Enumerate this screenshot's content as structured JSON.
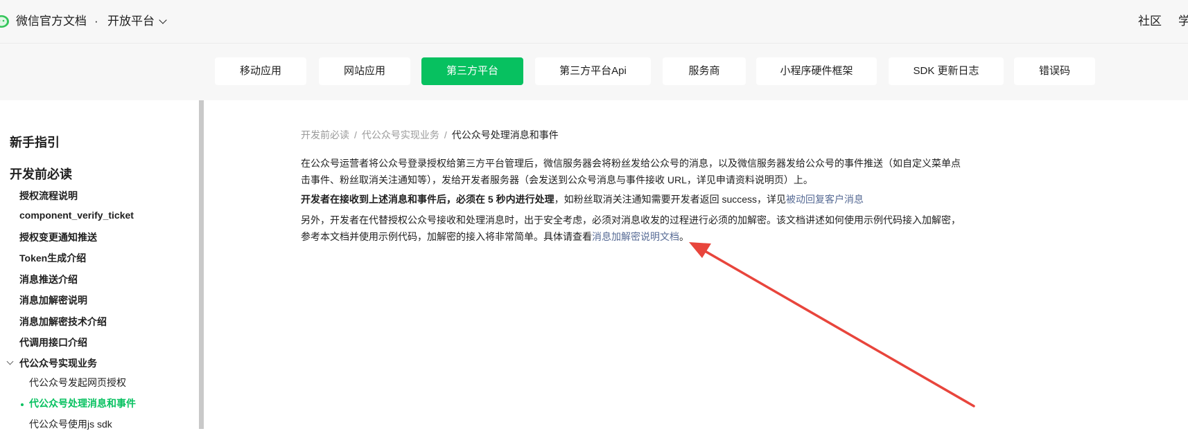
{
  "header": {
    "site_title": "微信官方文档",
    "separator": "·",
    "platform_label": "开放平台",
    "nav_right": [
      "社区",
      "学"
    ]
  },
  "tabs": [
    {
      "label": "移动应用",
      "active": false
    },
    {
      "label": "网站应用",
      "active": false
    },
    {
      "label": "第三方平台",
      "active": true
    },
    {
      "label": "第三方平台Api",
      "active": false
    },
    {
      "label": "服务商",
      "active": false
    },
    {
      "label": "小程序硬件框架",
      "active": false
    },
    {
      "label": "SDK 更新日志",
      "active": false
    },
    {
      "label": "错误码",
      "active": false
    }
  ],
  "sidebar": {
    "headings": [
      "新手指引",
      "开发前必读"
    ],
    "items": [
      "授权流程说明",
      "component_verify_ticket",
      "授权变更通知推送",
      "Token生成介绍",
      "消息推送介绍",
      "消息加解密说明",
      "消息加解密技术介绍",
      "代调用接口介绍",
      "代公众号实现业务"
    ],
    "sub_items": [
      "代公众号发起网页授权",
      "代公众号处理消息和事件",
      "代公众号使用js sdk"
    ]
  },
  "breadcrumb": {
    "items": [
      "开发前必读",
      "代公众号实现业务"
    ],
    "separator": "/",
    "current": "代公众号处理消息和事件"
  },
  "content": {
    "p1_line1": "在公众号运营者将公众号登录授权给第三方平台管理后，微信服务器会将粉丝发给公众号的消息，以及微信服务器发给公众号的事件推送（如自定义菜单点",
    "p1_line2": "击事件、粉丝取消关注通知等），发给开发者服务器（会发送到公众号消息与事件接收 URL，详见申请资料说明页）上。",
    "p2_bold": "开发者在接收到上述消息和事件后，必须在 5 秒内进行处理",
    "p2_text": "，如粉丝取消关注通知需要开发者返回 success，详见",
    "p2_link": "被动回复客户消息",
    "p3_line1": "另外，开发者在代替授权公众号接收和处理消息时，出于安全考虑，必须对消息收发的过程进行必须的加解密。该文档讲述如何使用示例代码接入加解密，",
    "p3_line2_text": "参考本文档并使用示例代码，加解密的接入将非常简单。具体请查看",
    "p3_link": "消息加解密说明文档",
    "p3_end": "。"
  },
  "colors": {
    "accent": "#07c160",
    "link": "#576b95",
    "annotation": "#e8453c"
  }
}
